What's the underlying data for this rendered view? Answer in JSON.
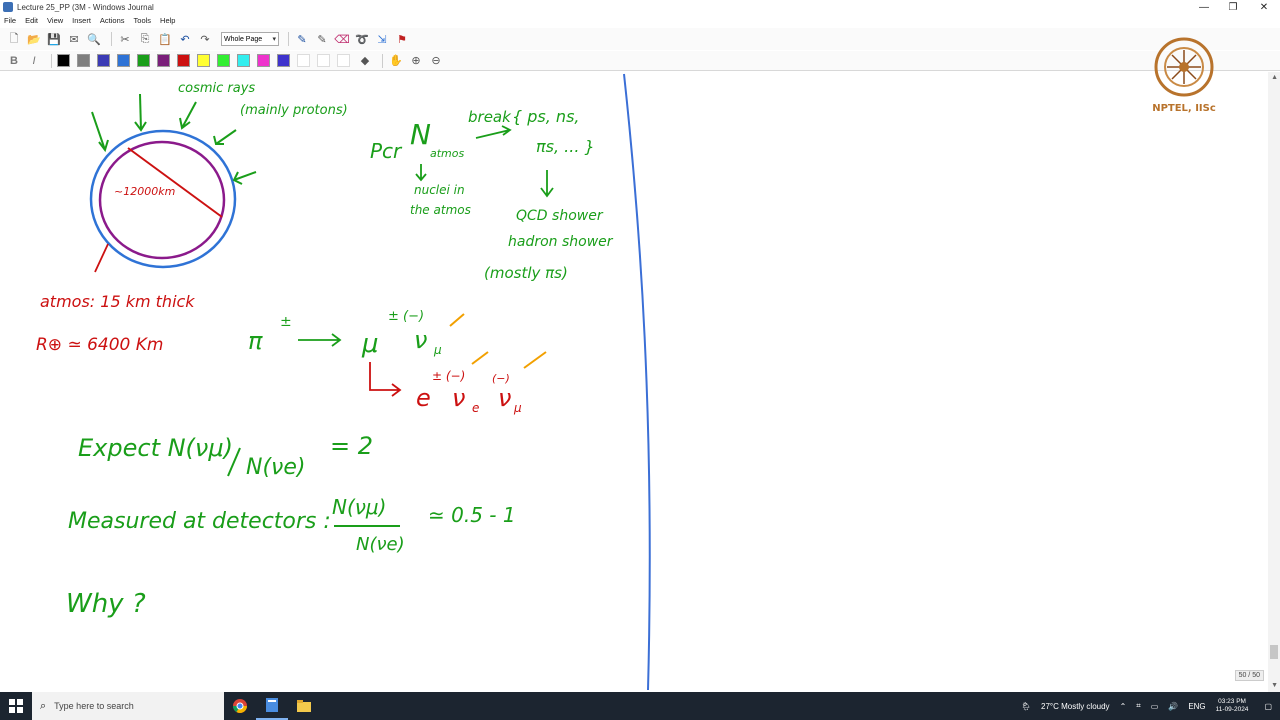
{
  "window": {
    "title": "Lecture 25_PP (3M - Windows Journal",
    "controls": {
      "minimize": "—",
      "restore": "❐",
      "close": "✕"
    }
  },
  "menu": [
    "File",
    "Edit",
    "View",
    "Insert",
    "Actions",
    "Tools",
    "Help"
  ],
  "toolbar": {
    "zoom_value": "Whole Page",
    "swatch_colors": [
      "#000000",
      "#7f7f7f",
      "#3b3bb5",
      "#2f73d6",
      "#1a9e1a",
      "#7a1f7a",
      "#cc1111",
      "#ffff33",
      "#33ee33",
      "#33eeee",
      "#ee33cc",
      "#3f33cc",
      "#ffffff",
      "#ffffff",
      "#ffffff"
    ]
  },
  "branding": {
    "label": "NPTEL, IISc"
  },
  "notes": {
    "cosmic_rays": "cosmic rays",
    "mainly_protons": "(mainly protons)",
    "diameter": "~12000km",
    "atmos_thick": "atmos: 15 km thick",
    "earth_radius": "R⊕ ≃ 6400 Km",
    "pcr": "Pcr",
    "n_atmos": "N",
    "atmos_sub": "atmos",
    "nuclei": "nuclei in",
    "the_atmos": "the atmos",
    "break": "break",
    "products1": "{ ps, ns,",
    "products2": "πs, ... }",
    "qcd": "QCD shower",
    "hadron": "hadron shower",
    "mostly": "(mostly πs)",
    "pion": "π",
    "pion_sup": "±",
    "muon": "μ",
    "muon_sup": "± (−)",
    "nu_mu": "ν",
    "nu_mu_sub": "μ",
    "electron": "e",
    "electron_sup": "± (−)",
    "nu_e": "ν",
    "nu_e_sub": "e",
    "nu_mu2_sup": "(−)",
    "nu_mu2": "ν",
    "nu_mu2_sub": "μ",
    "expect": "Expect  N(νμ)",
    "expect_den": "N(νe)",
    "expect_eq": "= 2",
    "measured": "Measured at detectors :",
    "measured_num": "N(νμ)",
    "measured_den": "N(νe)",
    "measured_eq": "≃  0.5 - 1",
    "why": "Why ?"
  },
  "page_counter": "50 / 50",
  "taskbar": {
    "search_placeholder": "Type here to search",
    "weather": "27°C  Mostly cloudy",
    "lang": "ENG",
    "time": "03:23 PM",
    "date": "11-09-2024"
  }
}
